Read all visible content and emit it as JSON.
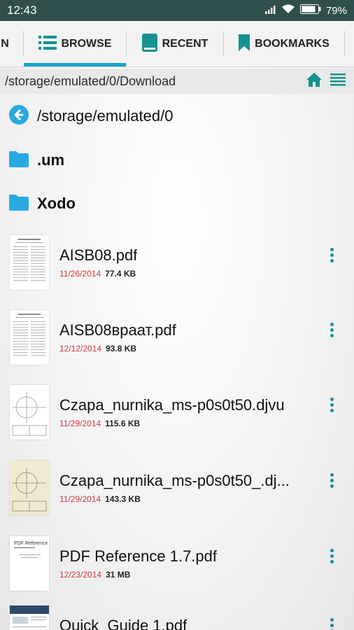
{
  "status_bar": {
    "time": "12:43",
    "battery": "79%"
  },
  "tabs": [
    {
      "label": "N"
    },
    {
      "label": "BROWSE",
      "selected": true
    },
    {
      "label": "RECENT"
    },
    {
      "label": "BOOKMARKS"
    }
  ],
  "path_bar": {
    "path": "/storage/emulated/0/Download"
  },
  "parent_row": {
    "name": "/storage/emulated/0"
  },
  "folders": [
    {
      "name": ".um"
    },
    {
      "name": "Xodo"
    }
  ],
  "files": [
    {
      "name": "AISB08.pdf",
      "date": "11/26/2014",
      "size": "77.4 KB"
    },
    {
      "name": "AISB08враат.pdf",
      "date": "12/12/2014",
      "size": "93.8 KB"
    },
    {
      "name": "Czapa_nurnika_ms-p0s0t50.djvu",
      "date": "11/29/2014",
      "size": "115.6 KB"
    },
    {
      "name": "Czapa_nurnika_ms-p0s0t50_.dj...",
      "date": "11/29/2014",
      "size": "143.3 KB"
    },
    {
      "name": "PDF Reference 1.7.pdf",
      "date": "12/23/2014",
      "size": "31 MB"
    },
    {
      "name": "Quick_Guide 1.pdf",
      "date": "",
      "size": ""
    }
  ],
  "thumb_texts": {
    "pdf_reference_title": "PDF Reference"
  },
  "colors": {
    "accent": "#169191",
    "tab_indicator": "#1aa3c9",
    "date": "#d23b3b",
    "folder": "#29a9e1",
    "status_bar": "#2f4e4c"
  }
}
